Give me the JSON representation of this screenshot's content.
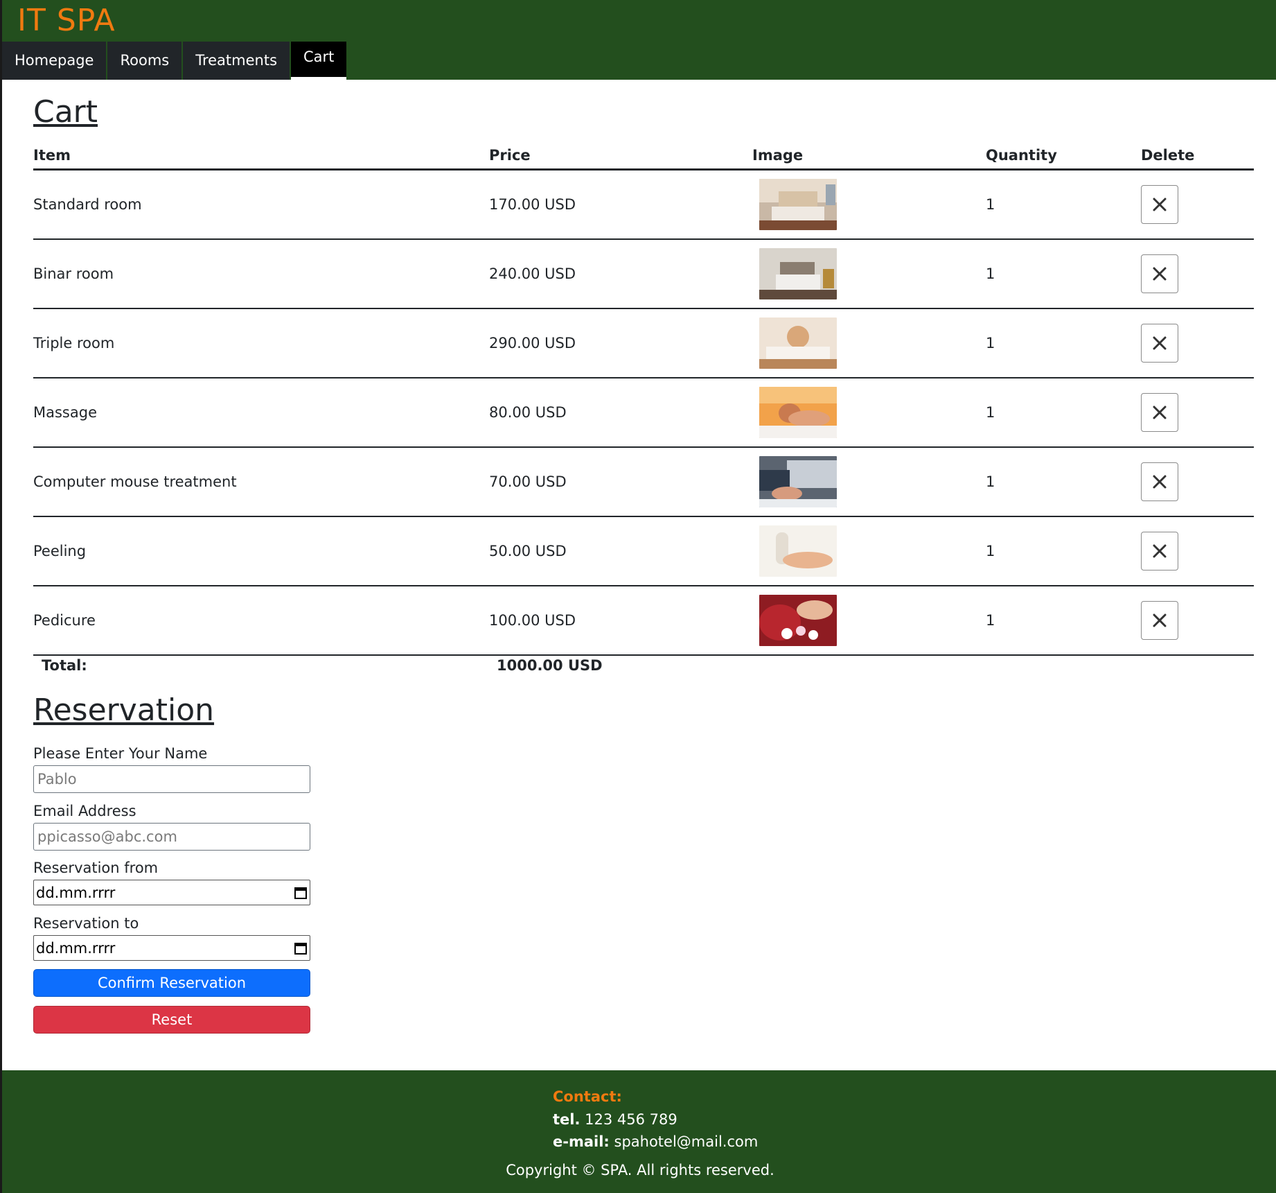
{
  "site": {
    "logo": "IT SPA"
  },
  "nav": {
    "items": [
      {
        "label": "Homepage"
      },
      {
        "label": "Rooms"
      },
      {
        "label": "Treatments"
      },
      {
        "label": "Cart"
      }
    ],
    "active": "Cart"
  },
  "cart": {
    "title": "Cart",
    "headers": {
      "item": "Item",
      "price": "Price",
      "image": "Image",
      "quantity": "Quantity",
      "delete": "Delete"
    },
    "rows": [
      {
        "item": "Standard room",
        "price": "170.00 USD",
        "quantity": "1",
        "image_icon": "bedroom-photo"
      },
      {
        "item": "Binar room",
        "price": "240.00 USD",
        "quantity": "1",
        "image_icon": "bedroom-photo"
      },
      {
        "item": "Triple room",
        "price": "290.00 USD",
        "quantity": "1",
        "image_icon": "bedroom-photo"
      },
      {
        "item": "Massage",
        "price": "80.00 USD",
        "quantity": "1",
        "image_icon": "massage-photo"
      },
      {
        "item": "Computer mouse treatment",
        "price": "70.00 USD",
        "quantity": "1",
        "image_icon": "computer-photo"
      },
      {
        "item": "Peeling",
        "price": "50.00 USD",
        "quantity": "1",
        "image_icon": "peeling-photo"
      },
      {
        "item": "Pedicure",
        "price": "100.00 USD",
        "quantity": "1",
        "image_icon": "pedicure-photo"
      }
    ],
    "total_label": "Total:",
    "total_value": "1000.00 USD"
  },
  "reservation": {
    "title": "Reservation",
    "name_label": "Please Enter Your Name",
    "name_placeholder": "Pablo",
    "email_label": "Email Address",
    "email_placeholder": "ppicasso@abc.com",
    "from_label": "Reservation from",
    "from_value": "dd.mm.rrrr",
    "to_label": "Reservation to",
    "to_value": "dd.mm.rrrr",
    "confirm_label": "Confirm Reservation",
    "reset_label": "Reset"
  },
  "footer": {
    "contact_title": "Contact:",
    "tel_label": "tel.",
    "tel_value": "123 456 789",
    "email_label": "e-mail:",
    "email_value": "spahotel@mail.com",
    "copyright": "Copyright © SPA. All rights reserved."
  },
  "colors": {
    "header_bg": "#234f1e",
    "logo": "#f07a10",
    "primary": "#0d6efd",
    "danger": "#dc3545"
  }
}
